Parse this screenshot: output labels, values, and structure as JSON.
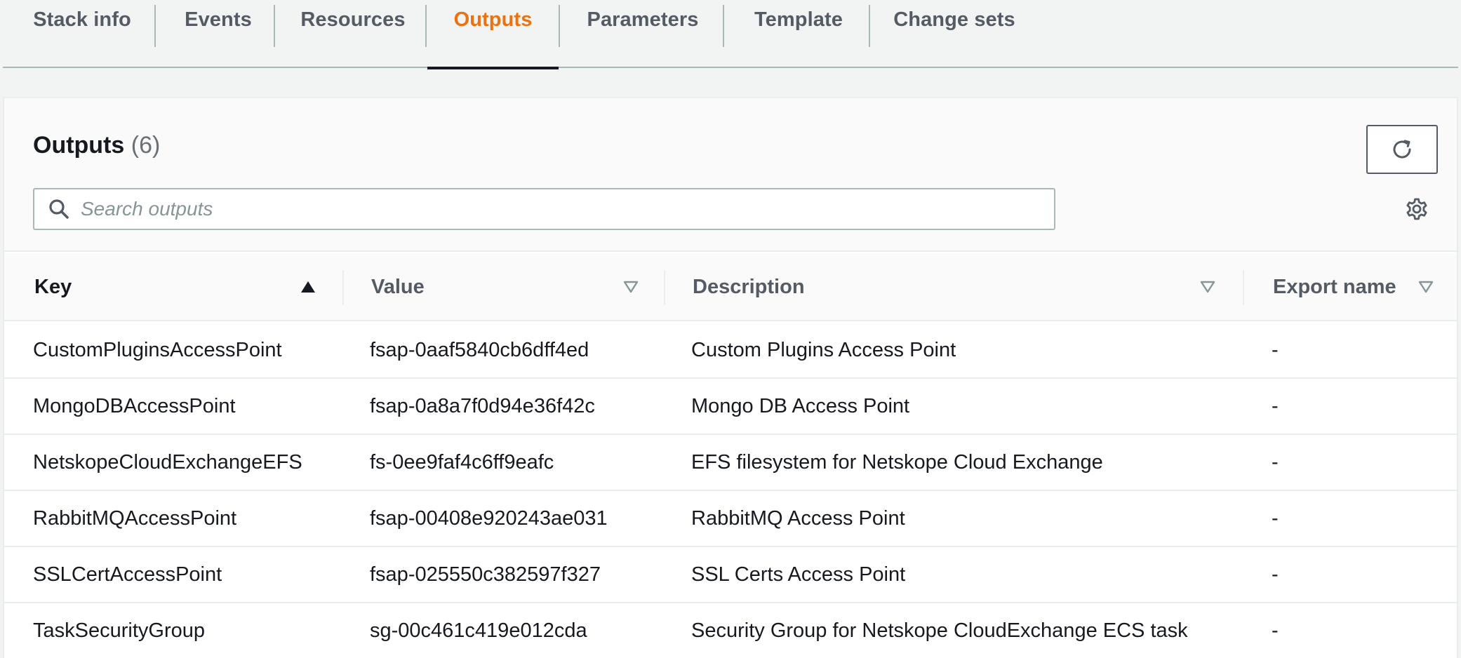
{
  "tabs": [
    {
      "label": "Stack info",
      "active": false
    },
    {
      "label": "Events",
      "active": false
    },
    {
      "label": "Resources",
      "active": false
    },
    {
      "label": "Outputs",
      "active": true
    },
    {
      "label": "Parameters",
      "active": false
    },
    {
      "label": "Template",
      "active": false
    },
    {
      "label": "Change sets",
      "active": false
    }
  ],
  "outputs": {
    "title": "Outputs",
    "count": "(6)",
    "search_placeholder": "Search outputs",
    "search_value": "",
    "refresh_icon": "refresh-icon",
    "settings_icon": "gear-icon"
  },
  "table": {
    "columns": [
      {
        "label": "Key",
        "sort": "ascending"
      },
      {
        "label": "Value",
        "sort": "none"
      },
      {
        "label": "Description",
        "sort": "none"
      },
      {
        "label": "Export name",
        "sort": "none"
      }
    ],
    "rows": [
      {
        "key": "CustomPluginsAccessPoint",
        "value": "fsap-0aaf5840cb6dff4ed",
        "description": "Custom Plugins Access Point",
        "export_name": "-"
      },
      {
        "key": "MongoDBAccessPoint",
        "value": "fsap-0a8a7f0d94e36f42c",
        "description": "Mongo DB Access Point",
        "export_name": "-"
      },
      {
        "key": "NetskopeCloudExchangeEFS",
        "value": "fs-0ee9faf4c6ff9eafc",
        "description": "EFS filesystem for Netskope Cloud Exchange",
        "export_name": "-"
      },
      {
        "key": "RabbitMQAccessPoint",
        "value": "fsap-00408e920243ae031",
        "description": "RabbitMQ Access Point",
        "export_name": "-"
      },
      {
        "key": "SSLCertAccessPoint",
        "value": "fsap-025550c382597f327",
        "description": "SSL Certs Access Point",
        "export_name": "-"
      },
      {
        "key": "TaskSecurityGroup",
        "value": "sg-00c461c419e012cda",
        "description": "Security Group for Netskope CloudExchange ECS task",
        "export_name": "-"
      }
    ]
  },
  "colors": {
    "active_tab": "#ec7211",
    "text": "#16191f",
    "muted": "#545b64",
    "border": "#aab7b8"
  }
}
